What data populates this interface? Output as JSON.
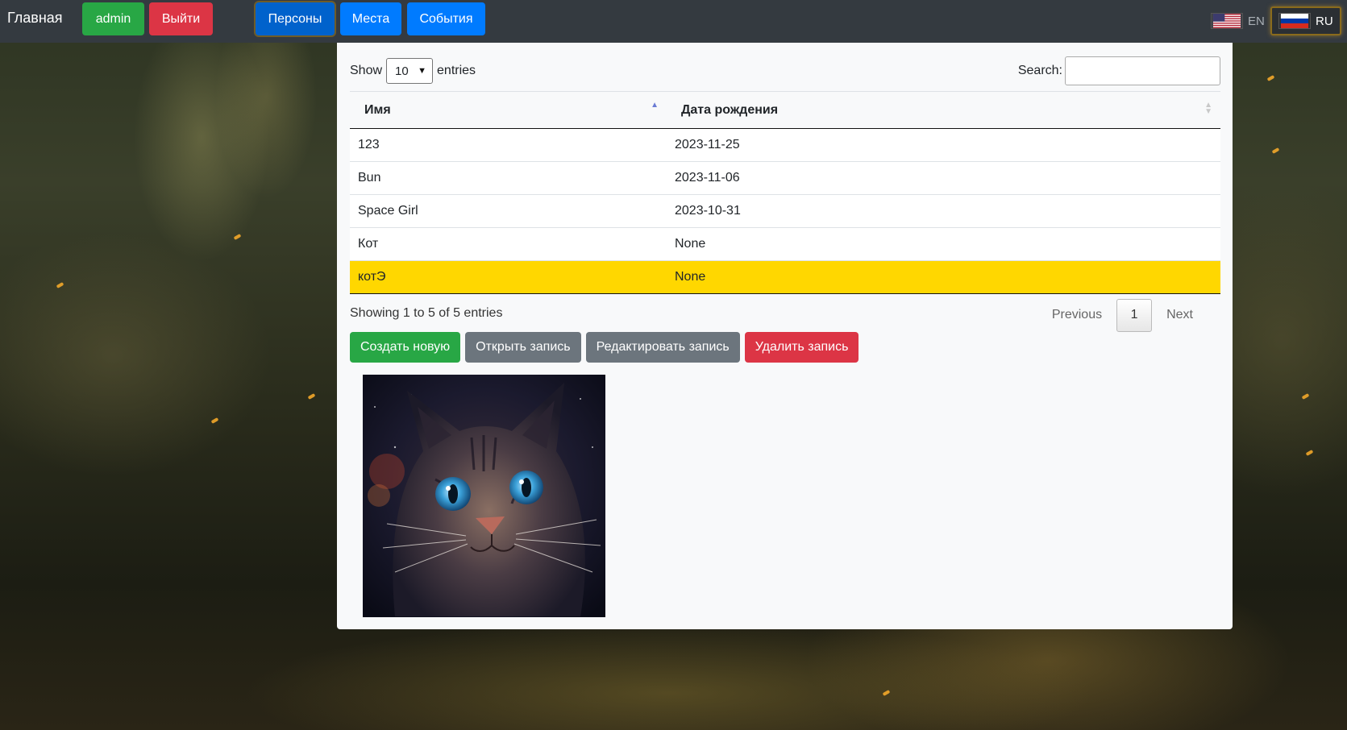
{
  "nav": {
    "brand": "Главная",
    "user_label": "admin",
    "logout_label": "Выйти",
    "links": [
      {
        "label": "Персоны"
      },
      {
        "label": "Места"
      },
      {
        "label": "События"
      }
    ],
    "languages": [
      {
        "code": "EN",
        "active": false
      },
      {
        "code": "RU",
        "active": true
      }
    ]
  },
  "table_controls": {
    "show_label": "Show",
    "page_length": "10",
    "entries_label": "entries",
    "search_label": "Search:",
    "search_value": ""
  },
  "table": {
    "columns": [
      "Имя",
      "Дата рождения"
    ],
    "rows": [
      {
        "name": "123",
        "birth_date": "2023-11-25"
      },
      {
        "name": "Bun",
        "birth_date": "2023-11-06"
      },
      {
        "name": "Space Girl",
        "birth_date": "2023-10-31"
      },
      {
        "name": "Кот",
        "birth_date": "None"
      },
      {
        "name": "котЭ",
        "birth_date": "None"
      }
    ],
    "selected_row": 4
  },
  "footer": {
    "info": "Showing 1 to 5 of 5 entries",
    "previous_label": "Previous",
    "current_page": "1",
    "next_label": "Next"
  },
  "actions": {
    "create_label": "Создать новую",
    "open_label": "Открыть запись",
    "edit_label": "Редактировать запись",
    "delete_label": "Удалить запись"
  },
  "colors": {
    "success": "#28a745",
    "danger": "#dc3545",
    "primary": "#007bff",
    "secondary": "#6c757d",
    "selected_row": "#ffd700",
    "navbar": "#343a40"
  }
}
